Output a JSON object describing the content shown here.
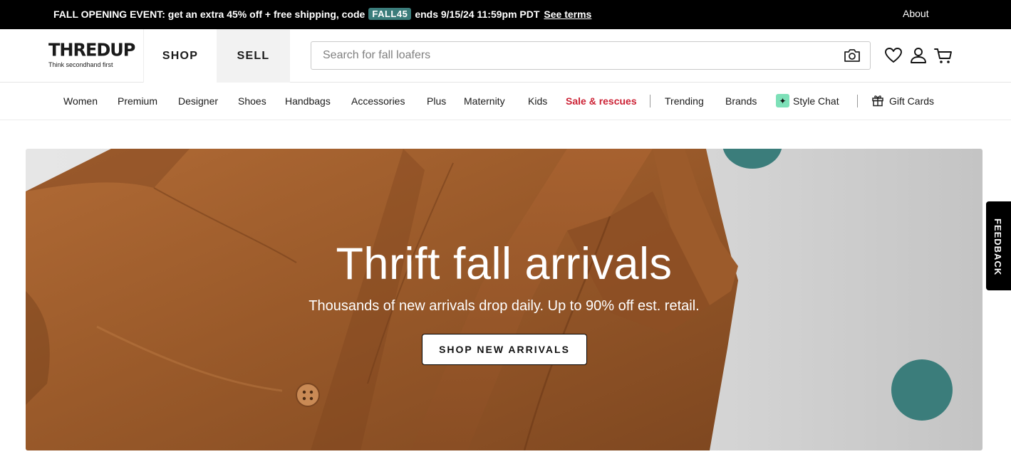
{
  "promo": {
    "text": "FALL OPENING EVENT: get an extra 45% off + free shipping, code",
    "code": "FALL45",
    "ends": "ends 9/15/24 11:59pm PDT",
    "terms_link": "See terms",
    "about_link": "About"
  },
  "header": {
    "logo": "THREDUP",
    "tagline": "Think secondhand first",
    "tabs": [
      {
        "label": "SHOP",
        "active": true
      },
      {
        "label": "SELL",
        "active": false
      }
    ],
    "search_placeholder": "Search for fall loafers",
    "icons": [
      "camera-icon",
      "heart-icon",
      "user-icon",
      "cart-icon"
    ]
  },
  "categories": {
    "items": [
      "Women",
      "Premium",
      "Designer",
      "Shoes",
      "Handbags",
      "Accessories",
      "Plus",
      "Maternity",
      "Kids",
      "Sale & rescues",
      "Trending",
      "Brands",
      "Style Chat",
      "Gift Cards"
    ],
    "sale_color": "#cc2235"
  },
  "hero": {
    "title": "Thrift fall arrivals",
    "subtitle": "Thousands of new arrivals drop daily. Up to 90% off est. retail.",
    "button": "SHOP NEW ARRIVALS",
    "accent_color": "#3b7d7b",
    "jacket_color": "#9a5a2a"
  },
  "feedback": {
    "label": "FEEDBACK"
  }
}
